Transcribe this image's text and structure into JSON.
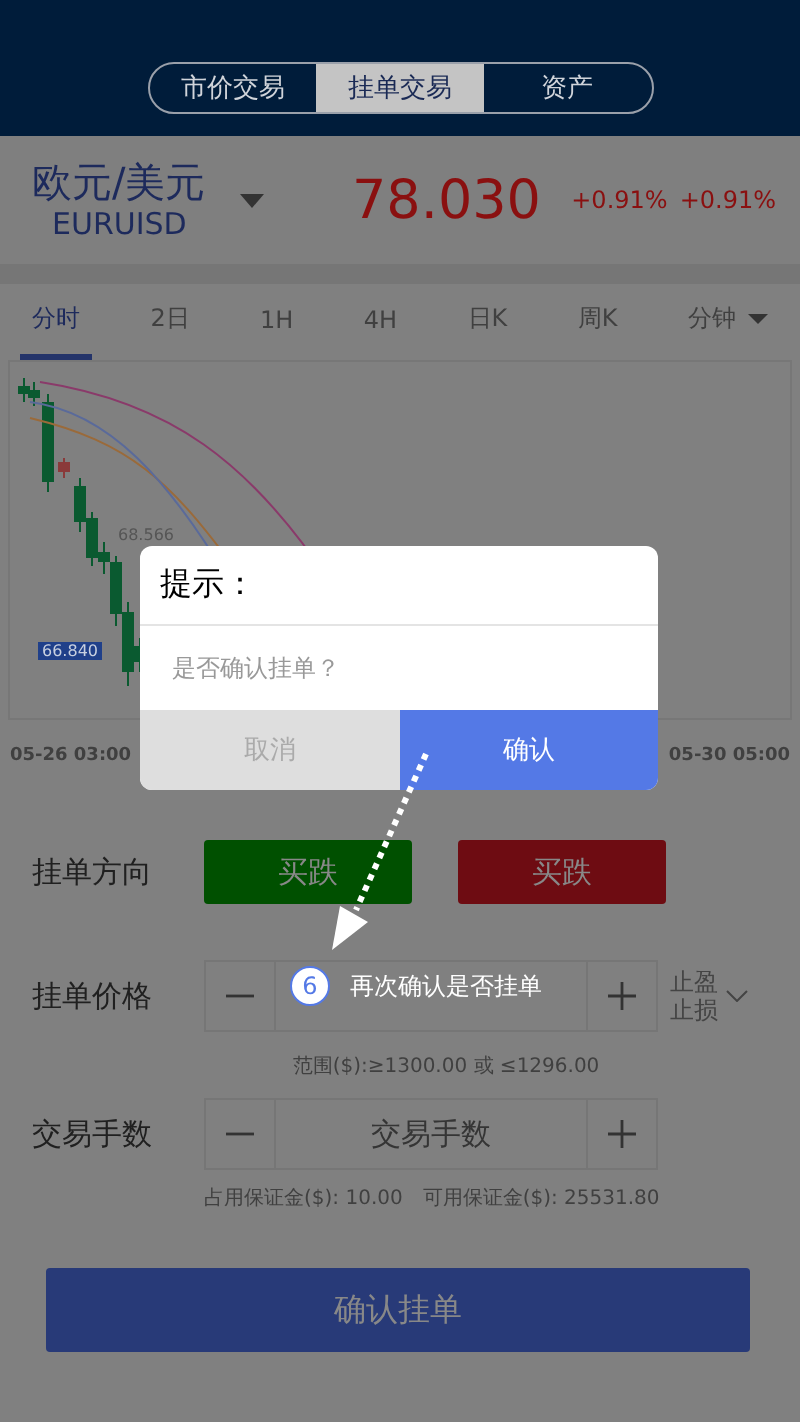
{
  "header": {
    "tabs": [
      {
        "label": "市价交易",
        "selected": false
      },
      {
        "label": "挂单交易",
        "selected": true
      },
      {
        "label": "资产",
        "selected": false
      }
    ]
  },
  "quote": {
    "name": "欧元/美元",
    "code": "EURUISD",
    "price": "78.030",
    "changes": [
      "+0.91%",
      "+0.91%"
    ]
  },
  "periods": [
    {
      "label": "分时",
      "selected": true,
      "kind": "tab"
    },
    {
      "label": "2日",
      "selected": false,
      "kind": "tab"
    },
    {
      "label": "1H",
      "selected": false,
      "kind": "tab"
    },
    {
      "label": "4H",
      "selected": false,
      "kind": "tab"
    },
    {
      "label": "日K",
      "selected": false,
      "kind": "tab"
    },
    {
      "label": "周K",
      "selected": false,
      "kind": "tab"
    },
    {
      "label": "分钟",
      "selected": false,
      "kind": "dropdown"
    }
  ],
  "chart": {
    "price_label": "68.566",
    "current_price": "66.840",
    "time_labels": [
      "05-26 03:00",
      "05-30 05:00"
    ]
  },
  "dialog": {
    "title": "提示：",
    "message": "是否确认挂单？",
    "buttons": [
      {
        "label": "取消",
        "kind": "cancel"
      },
      {
        "label": "确认",
        "kind": "confirm"
      }
    ]
  },
  "form": {
    "direction": {
      "label": "挂单方向",
      "buttons": [
        {
          "label": "买跌",
          "color": "#005000"
        },
        {
          "label": "买跌",
          "color": "#6e0c12"
        }
      ]
    },
    "price": {
      "label": "挂单价格",
      "option": "止盈止损",
      "hint": "范围($):≥1300.00 或 ≤1296.00"
    },
    "lots": {
      "label": "交易手数",
      "placeholder": "交易手数",
      "hint_used": "占用保证金($): 10.00",
      "hint_free": "可用保证金($): 25531.80"
    },
    "submit": "确认挂单"
  },
  "annotation": {
    "step": "6",
    "text": "再次确认是否挂单"
  }
}
